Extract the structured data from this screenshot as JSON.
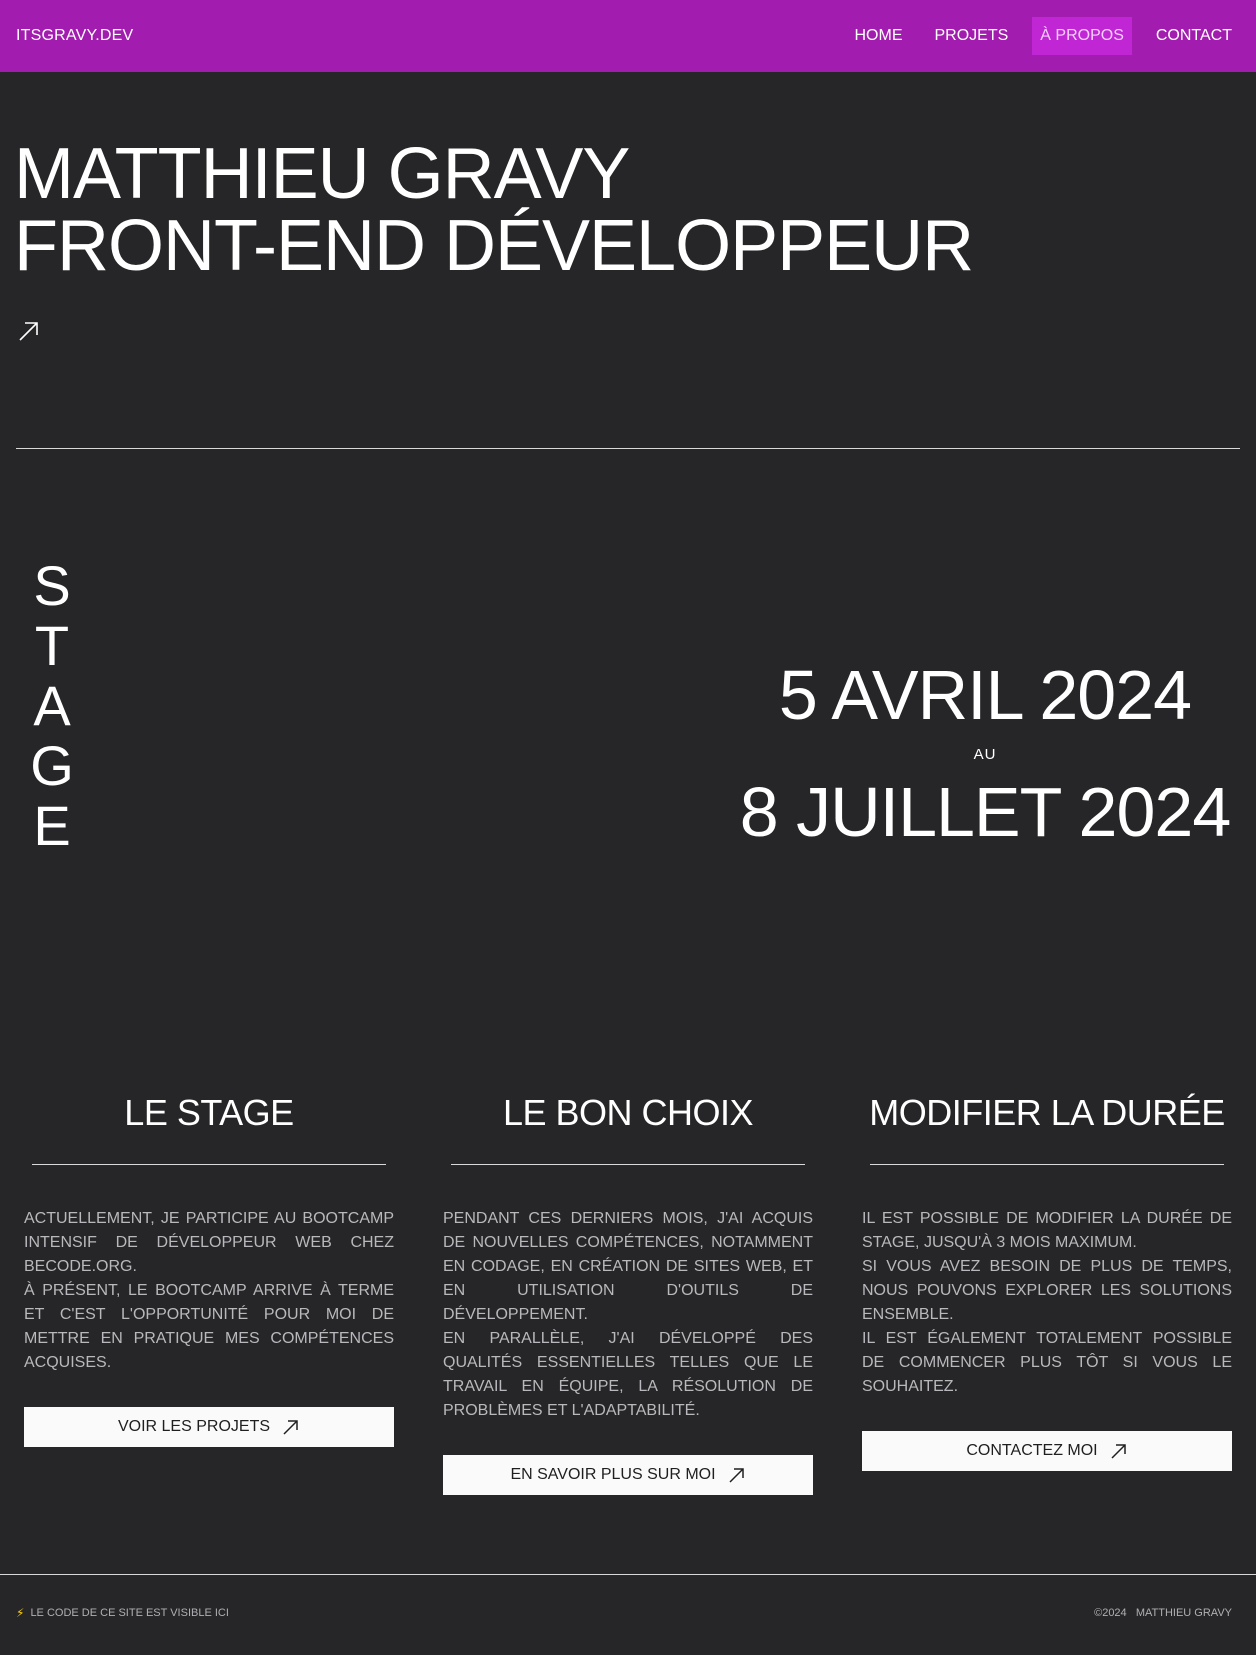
{
  "navbar": {
    "brand": "ITSGRAVY.DEV",
    "items": [
      {
        "label": "HOME"
      },
      {
        "label": "PROJETS"
      },
      {
        "label": "À PROPOS"
      },
      {
        "label": "CONTACT"
      }
    ],
    "active_index": 2,
    "accent_color": "#a21caf"
  },
  "hero": {
    "line1": "MATTHIEU GRAVY",
    "line2": "FRONT-END DÉVELOPPEUR",
    "arrow_icon": "arrow-up-right-icon"
  },
  "stage": {
    "letters": [
      "S",
      "T",
      "A",
      "G",
      "E"
    ]
  },
  "dates": {
    "start": "5 AVRIL 2024",
    "separator": "AU",
    "end": "8 JUILLET 2024"
  },
  "cards": [
    {
      "title": "LE STAGE",
      "paragraphs": [
        "ACTUELLEMENT, JE PARTICIPE AU BOOTCAMP INTENSIF DE DÉVELOPPEUR WEB CHEZ BECODE.ORG.",
        "À PRÉSENT, LE BOOTCAMP ARRIVE À TERME ET C'EST L'OPPORTUNITÉ POUR MOI DE METTRE EN PRATIQUE MES COMPÉTENCES ACQUISES."
      ],
      "button": "VOIR LES PROJETS"
    },
    {
      "title": "LE BON CHOIX",
      "paragraphs": [
        "PENDANT CES DERNIERS MOIS, J'AI ACQUIS DE NOUVELLES COMPÉTENCES, NOTAMMENT EN CODAGE, EN CRÉATION DE SITES WEB, ET EN UTILISATION D'OUTILS DE DÉVELOPPEMENT.",
        "EN PARALLÈLE, J'AI DÉVELOPPÉ DES QUALITÉS ESSENTIELLES TELLES QUE LE TRAVAIL EN ÉQUIPE, LA RÉSOLUTION DE PROBLÈMES ET L'ADAPTABILITÉ."
      ],
      "button": "EN SAVOIR PLUS SUR MOI"
    },
    {
      "title": "MODIFIER LA DURÉE",
      "paragraphs": [
        "IL EST POSSIBLE DE MODIFIER LA DURÉE DE STAGE, JUSQU'À 3 MOIS MAXIMUM.",
        "SI VOUS AVEZ BESOIN DE PLUS DE TEMPS, NOUS POUVONS EXPLORER LES SOLUTIONS ENSEMBLE.",
        "IL EST ÉGALEMENT TOTALEMENT POSSIBLE DE COMMENCER PLUS TÔT SI VOUS LE SOUHAITEZ."
      ],
      "button": "CONTACTEZ MOI"
    }
  ],
  "footer": {
    "bolt_icon": "⚡",
    "source_text": "LE CODE DE CE SITE EST VISIBLE ICI",
    "copyright": "©2024",
    "author": "MATTHIEU GRAVY"
  }
}
